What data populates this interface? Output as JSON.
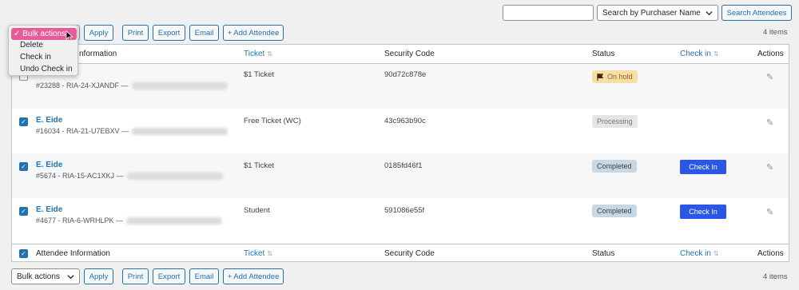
{
  "search": {
    "placeholder": "",
    "filter_value": "Search by Purchaser Name",
    "button": "Search Attendees"
  },
  "toolbar": {
    "bulk_actions": "Bulk actions",
    "apply": "Apply",
    "print": "Print",
    "export": "Export",
    "email": "Email",
    "add_attendee": "+ Add Attendee",
    "items_count": "4 items"
  },
  "dropdown": {
    "selected": "✓ Bulk actions",
    "options": [
      "Delete",
      "Check in",
      "Undo Check in"
    ]
  },
  "table": {
    "headers": {
      "attendee": "Attendee Information",
      "attendee_partial": "nformation",
      "ticket": "Ticket",
      "security": "Security Code",
      "status": "Status",
      "checkin": "Check in",
      "actions": "Actions"
    },
    "rows": [
      {
        "name": "",
        "meta": "#23288 - RIA-24-XJANDF —",
        "ticket": "$1 Ticket",
        "code": "90d72c878e",
        "status": "On hold",
        "checkin": ""
      },
      {
        "name": "E. Eide",
        "meta": "#16034 - RIA-21-U7EBXV —",
        "ticket": "Free Ticket (WC)",
        "code": "43c963b90c",
        "status": "Processing",
        "checkin": ""
      },
      {
        "name": "E. Eide",
        "meta": "#5674 - RIA-15-AC1XKJ —",
        "ticket": "$1 Ticket",
        "code": "0185fd46f1",
        "status": "Completed",
        "checkin": "Check In"
      },
      {
        "name": "E. Eide",
        "meta": "#4677 - RIA-6-WRHLPK —",
        "ticket": "Student",
        "code": "591086e55f",
        "status": "Completed",
        "checkin": "Check In"
      }
    ]
  },
  "colors": {
    "accent": "#2271b1",
    "checkin_button": "#2a57e8",
    "dropdown_highlight": "#e85b9b"
  }
}
